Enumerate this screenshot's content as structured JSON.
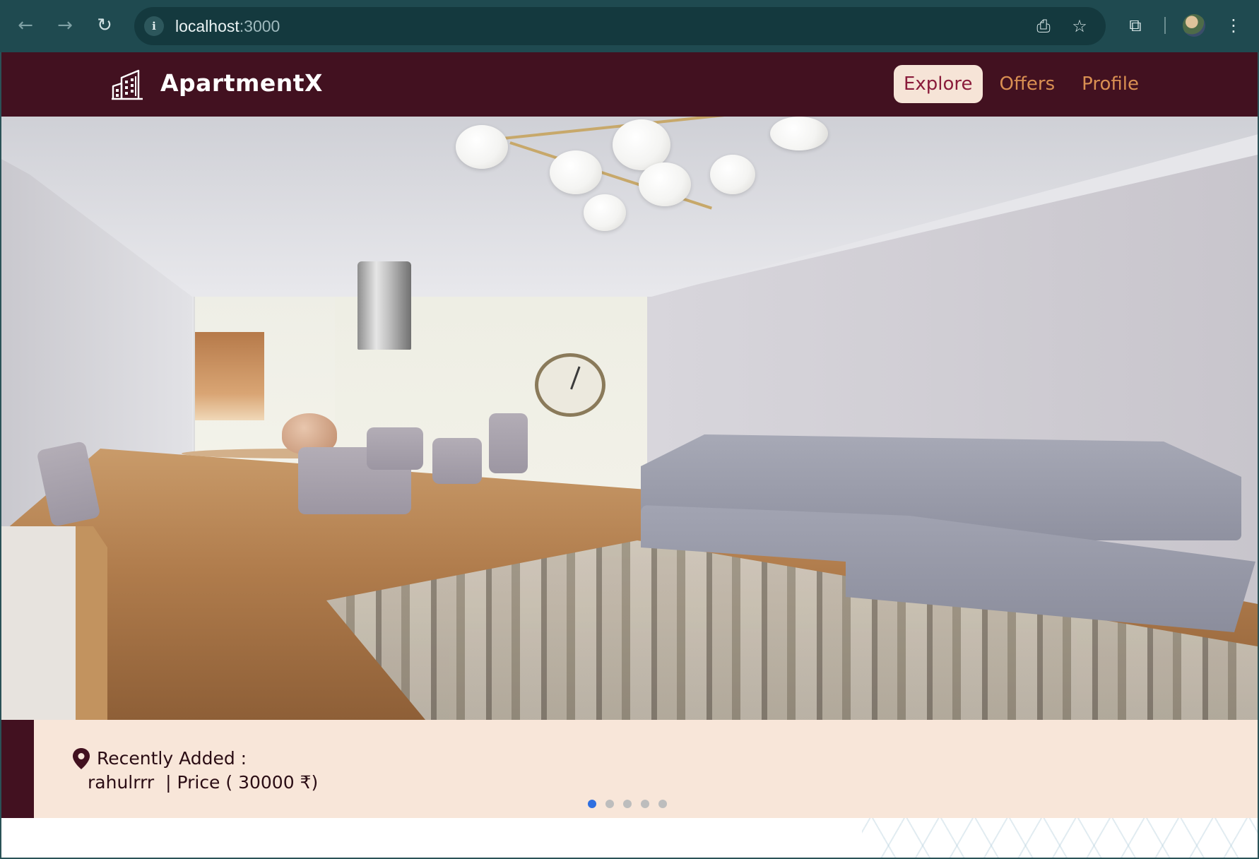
{
  "browser": {
    "url_host": "localhost",
    "url_port": ":3000",
    "icons": [
      "back-icon",
      "forward-icon",
      "reload-icon",
      "info-icon",
      "install-icon",
      "bookmark-star-icon",
      "extensions-icon",
      "profile-avatar",
      "menu-icon"
    ]
  },
  "header": {
    "brand": "ApartmentX",
    "nav": [
      {
        "label": "Explore",
        "active": true
      },
      {
        "label": "Offers",
        "active": false
      },
      {
        "label": "Profile",
        "active": false
      }
    ]
  },
  "carousel": {
    "caption_title": "Recently Added :",
    "caption_detail": "rahulrrr  | Price ( 30000 ₹)",
    "slide_count": 5,
    "active_index": 0
  },
  "colors": {
    "header_bg": "#421120",
    "nav_active_bg": "#f6e4d7",
    "nav_active_text": "#8a1b3b",
    "nav_text": "#d98f52",
    "caption_bg": "#f8e6d9",
    "dot_active": "#2f6fe0"
  }
}
